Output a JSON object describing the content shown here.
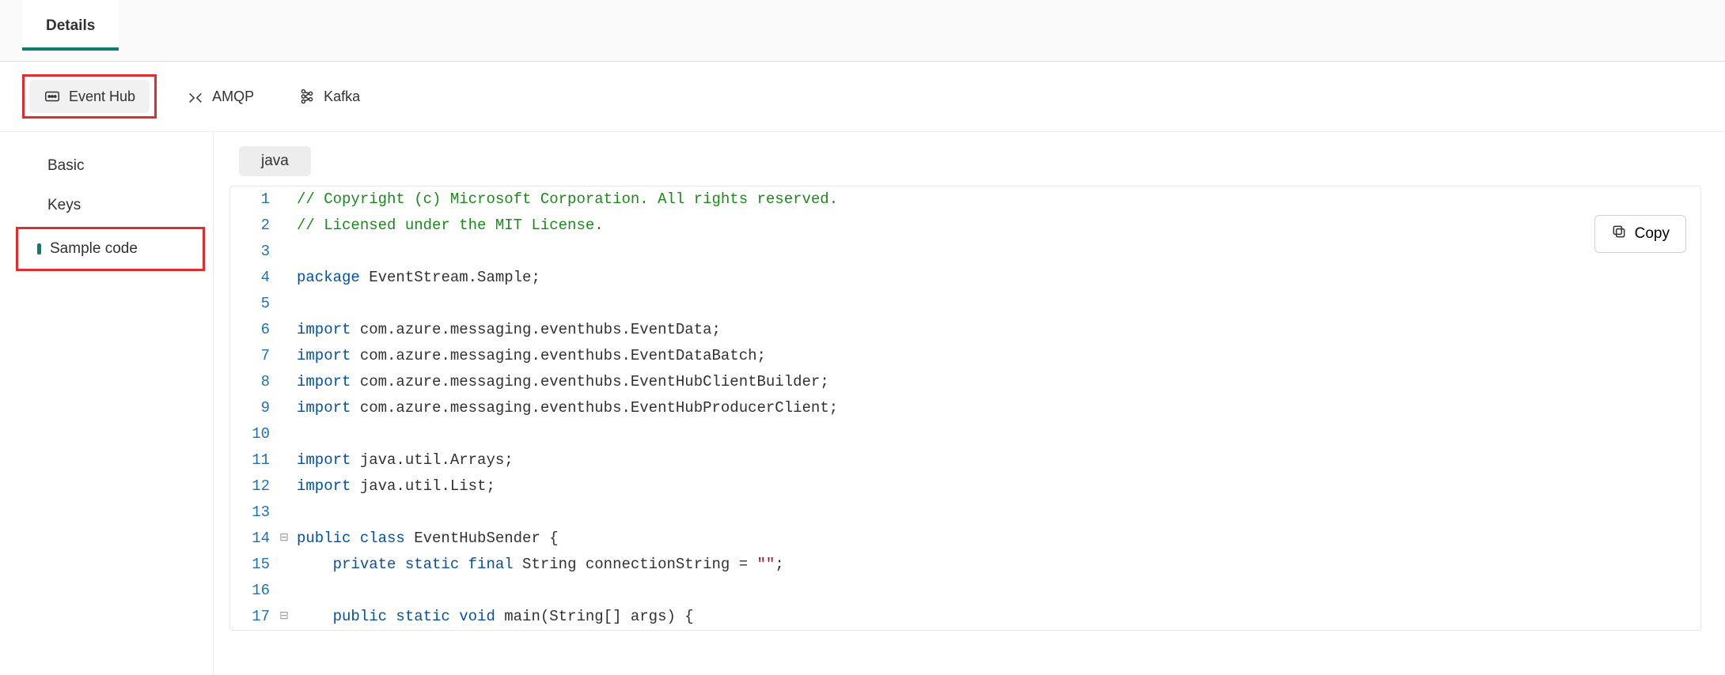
{
  "topTab": {
    "label": "Details"
  },
  "protocols": [
    {
      "id": "eventhub",
      "label": "Event Hub",
      "highlighted": true,
      "selected": true
    },
    {
      "id": "amqp",
      "label": "AMQP",
      "highlighted": false,
      "selected": false
    },
    {
      "id": "kafka",
      "label": "Kafka",
      "highlighted": false,
      "selected": false
    }
  ],
  "sidebar": {
    "items": [
      {
        "id": "basic",
        "label": "Basic",
        "active": false,
        "highlighted": false
      },
      {
        "id": "keys",
        "label": "Keys",
        "active": false,
        "highlighted": false
      },
      {
        "id": "sample",
        "label": "Sample code",
        "active": true,
        "highlighted": true
      }
    ]
  },
  "codePanel": {
    "languageChip": "java",
    "copyLabel": "Copy",
    "lines": [
      {
        "n": 1,
        "fold": "",
        "segs": [
          {
            "c": "comment",
            "t": "// Copyright (c) Microsoft Corporation. All rights reserved."
          }
        ]
      },
      {
        "n": 2,
        "fold": "",
        "segs": [
          {
            "c": "comment",
            "t": "// Licensed under the MIT License."
          }
        ]
      },
      {
        "n": 3,
        "fold": "",
        "segs": []
      },
      {
        "n": 4,
        "fold": "",
        "segs": [
          {
            "c": "keyword",
            "t": "package"
          },
          {
            "c": "plain",
            "t": " EventStream.Sample;"
          }
        ]
      },
      {
        "n": 5,
        "fold": "",
        "segs": []
      },
      {
        "n": 6,
        "fold": "",
        "segs": [
          {
            "c": "keyword",
            "t": "import"
          },
          {
            "c": "plain",
            "t": " com.azure.messaging.eventhubs.EventData;"
          }
        ]
      },
      {
        "n": 7,
        "fold": "",
        "segs": [
          {
            "c": "keyword",
            "t": "import"
          },
          {
            "c": "plain",
            "t": " com.azure.messaging.eventhubs.EventDataBatch;"
          }
        ]
      },
      {
        "n": 8,
        "fold": "",
        "segs": [
          {
            "c": "keyword",
            "t": "import"
          },
          {
            "c": "plain",
            "t": " com.azure.messaging.eventhubs.EventHubClientBuilder;"
          }
        ]
      },
      {
        "n": 9,
        "fold": "",
        "segs": [
          {
            "c": "keyword",
            "t": "import"
          },
          {
            "c": "plain",
            "t": " com.azure.messaging.eventhubs.EventHubProducerClient;"
          }
        ]
      },
      {
        "n": 10,
        "fold": "",
        "segs": []
      },
      {
        "n": 11,
        "fold": "",
        "segs": [
          {
            "c": "keyword",
            "t": "import"
          },
          {
            "c": "plain",
            "t": " java.util.Arrays;"
          }
        ]
      },
      {
        "n": 12,
        "fold": "",
        "segs": [
          {
            "c": "keyword",
            "t": "import"
          },
          {
            "c": "plain",
            "t": " java.util.List;"
          }
        ]
      },
      {
        "n": 13,
        "fold": "",
        "segs": []
      },
      {
        "n": 14,
        "fold": "⊟",
        "segs": [
          {
            "c": "keyword",
            "t": "public class"
          },
          {
            "c": "plain",
            "t": " EventHubSender {"
          }
        ]
      },
      {
        "n": 15,
        "fold": "",
        "segs": [
          {
            "c": "plain",
            "t": "    "
          },
          {
            "c": "keyword",
            "t": "private static final"
          },
          {
            "c": "plain",
            "t": " String connectionString = "
          },
          {
            "c": "string",
            "t": "\"\""
          },
          {
            "c": "plain",
            "t": ";"
          }
        ]
      },
      {
        "n": 16,
        "fold": "",
        "segs": []
      },
      {
        "n": 17,
        "fold": "⊟",
        "segs": [
          {
            "c": "plain",
            "t": "    "
          },
          {
            "c": "keyword",
            "t": "public static void"
          },
          {
            "c": "plain",
            "t": " main(String[] args) {"
          }
        ]
      }
    ]
  }
}
